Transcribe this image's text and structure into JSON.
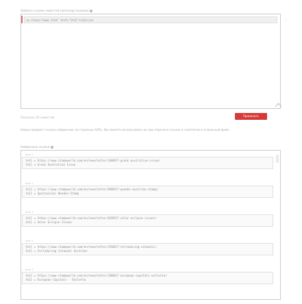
{
  "section1": {
    "label": "Шаблон ссылки новостей (автоподстановка)",
    "code_value": "<a class=\"news-link\" href=\"{%1}\">{%2}</a>",
    "side_left_mark": "",
    "side_right_mark": "◦"
  },
  "controls": {
    "count_label": "Показано 20 новостей",
    "button_label": "Применить"
  },
  "description": "Новые предмет ссылок найденные на странице (URL). Вы можете использовать их при переносе ссылок и сниппетов в отдельный файл.",
  "section2": {
    "label": "Найденные ссылки",
    "items": [
      {
        "head": "item 1",
        "line1": "{%1} = https://www.stampworld.com/en/newsletter/160917-great-australian-issue/",
        "line2": "{%2} = Great Australian Issue"
      },
      {
        "head": "item 2",
        "line1": "{%1} = https://www.stampworld.com/en/newsletter/090917-wooden-austrian-stamp/",
        "line2": "{%2} = Spectacular Wooden Stamp"
      },
      {
        "head": "item 3",
        "line1": "{%1} = https://www.stampworld.com/en/newsletter/020917-solar-eclipse-issues/",
        "line2": "{%2} = Solar Eclipse Issues"
      },
      {
        "head": "item 4",
        "line1": "{%1} = https://www.stampworld.com/en/newsletter/250817-introducing-catawiki/",
        "line2": "{%2} = Introducing Catawiki Auctions"
      },
      {
        "head": "item 5",
        "line1": "{%1} = https://www.stampworld.com/en/newsletter/180817-european-capitals-valletta/",
        "line2": "{%2} = European Capitals - Valletta"
      }
    ]
  },
  "colors": {
    "button": "#d53a3a",
    "border": "#c9c9c9"
  }
}
